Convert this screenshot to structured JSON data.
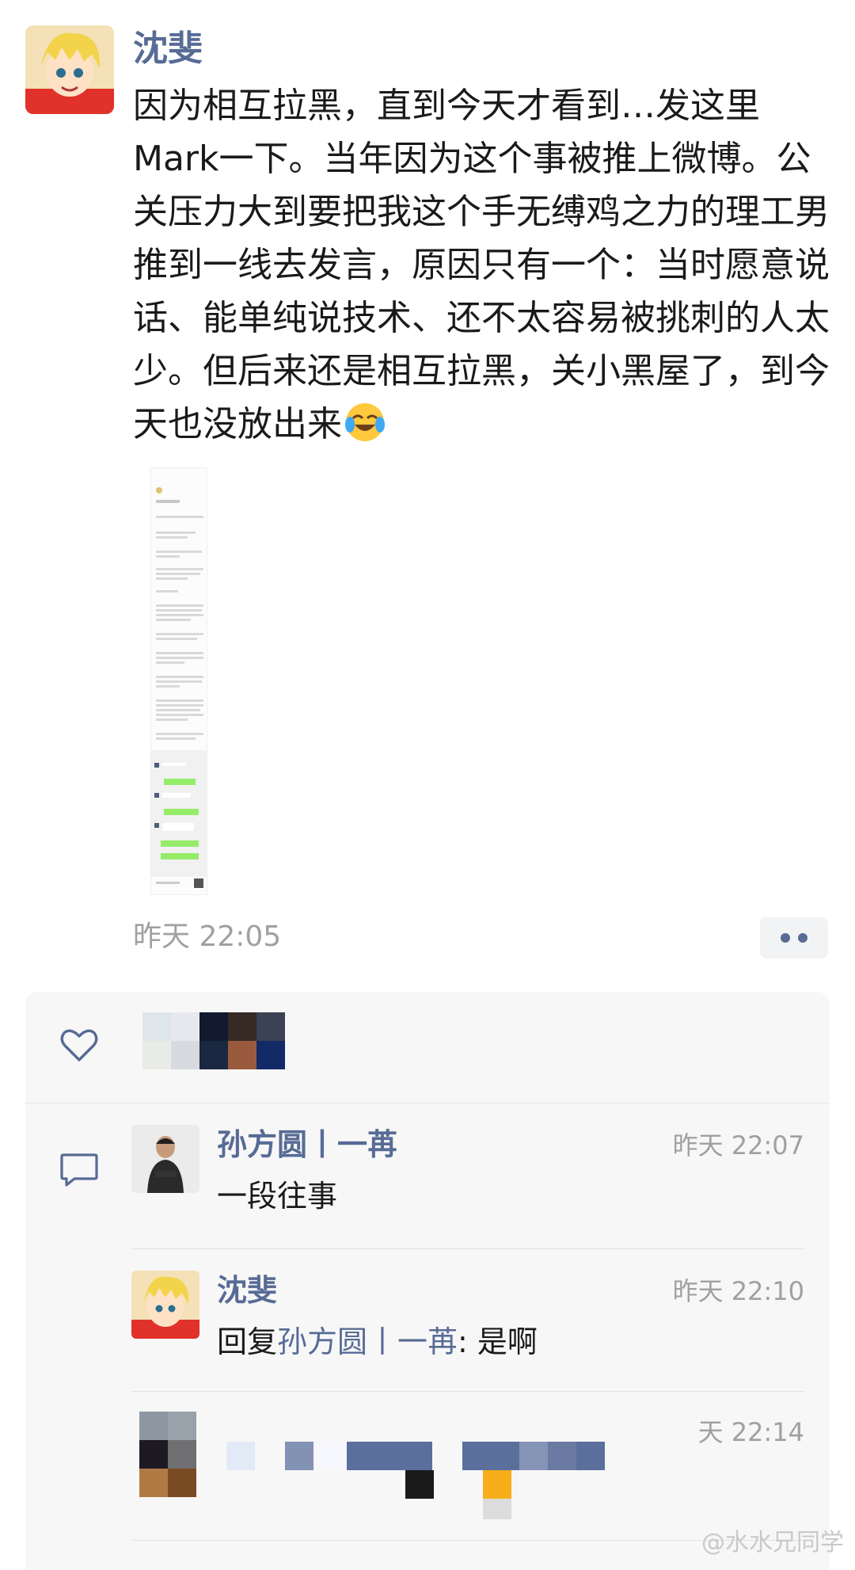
{
  "post": {
    "author": "沈斐",
    "text": "因为相互拉黑，直到今天才看到…发这里Mark一下。当年因为这个事被推上微博。公关压力大到要把我这个手无缚鸡之力的理工男推到一线去发言，原因只有一个：当时愿意说话、能单纯说技术、还不太容易被挑刺的人太少。但后来还是相互拉黑，关小黑屋了，到今天也没放出来",
    "time": "昨天 22:05",
    "emoji_icon": "crying-laughing-emoji"
  },
  "colors": {
    "name_link": "#576b95",
    "time_gray": "#a0a0a0",
    "panel_bg": "#f7f7f7"
  },
  "likes": {
    "icon": "heart-outline-icon"
  },
  "comments": [
    {
      "author": "孙方圆丨一苒",
      "time": "昨天 22:07",
      "text": "一段往事"
    },
    {
      "author": "沈斐",
      "time": "昨天 22:10",
      "reply_prefix": "回复",
      "reply_to": "孙方圆丨一苒",
      "reply_sep": ": ",
      "text": "是啊"
    },
    {
      "time": "天 22:14"
    }
  ],
  "watermark": "@水水兄同学"
}
